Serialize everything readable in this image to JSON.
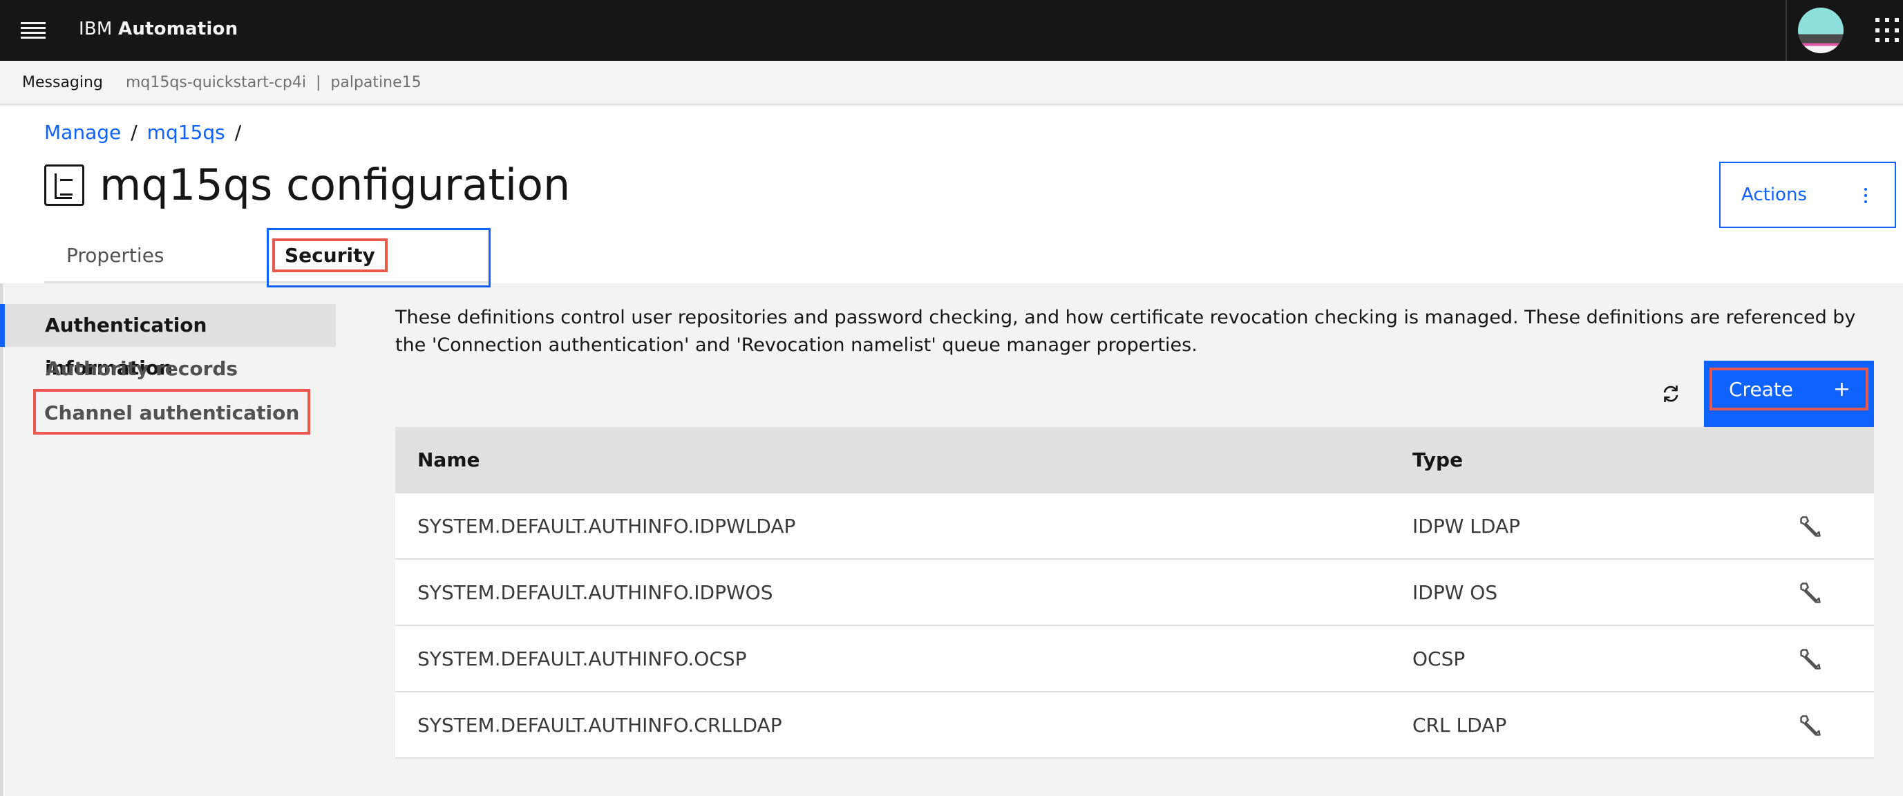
{
  "topbar": {
    "brand_prefix": "IBM",
    "brand_product": "Automation"
  },
  "context": {
    "label": "Messaging",
    "instance": "mq15qs-quickstart-cp4i",
    "separator": "|",
    "namespace": "palpatine15"
  },
  "breadcrumb": {
    "items": [
      "Manage",
      "mq15qs"
    ],
    "separator": "/"
  },
  "page": {
    "title": "mq15qs configuration",
    "actions_label": "Actions"
  },
  "tabs": [
    {
      "label": "Properties",
      "active": false
    },
    {
      "label": "Security",
      "active": true
    }
  ],
  "sidenav": {
    "items": [
      {
        "label": "Authentication information",
        "active": true
      },
      {
        "label": "Authority records",
        "active": false
      },
      {
        "label": "Channel authentication",
        "active": false
      }
    ]
  },
  "main": {
    "description": "These definitions control user repositories and password checking, and how certificate revocation checking is managed. These definitions are referenced by the 'Connection authentication' and 'Revocation namelist' queue manager properties.",
    "create_label": "Create",
    "create_icon": "+"
  },
  "table": {
    "headers": {
      "name": "Name",
      "type": "Type"
    },
    "rows": [
      {
        "name": "SYSTEM.DEFAULT.AUTHINFO.IDPWLDAP",
        "type": "IDPW LDAP"
      },
      {
        "name": "SYSTEM.DEFAULT.AUTHINFO.IDPWOS",
        "type": "IDPW OS"
      },
      {
        "name": "SYSTEM.DEFAULT.AUTHINFO.OCSP",
        "type": "OCSP"
      },
      {
        "name": "SYSTEM.DEFAULT.AUTHINFO.CRLLDAP",
        "type": "CRL LDAP"
      }
    ]
  },
  "colors": {
    "shell": "#161616",
    "accent": "#0f62fe",
    "highlight": "#e8584d"
  },
  "icons": {
    "menu": "hamburger-menu-icon",
    "user": "user-avatar",
    "switcher": "app-switcher-icon",
    "title": "queue-manager-icon",
    "more": "overflow-menu-icon",
    "refresh": "refresh-icon",
    "row_action": "wrench-icon"
  }
}
